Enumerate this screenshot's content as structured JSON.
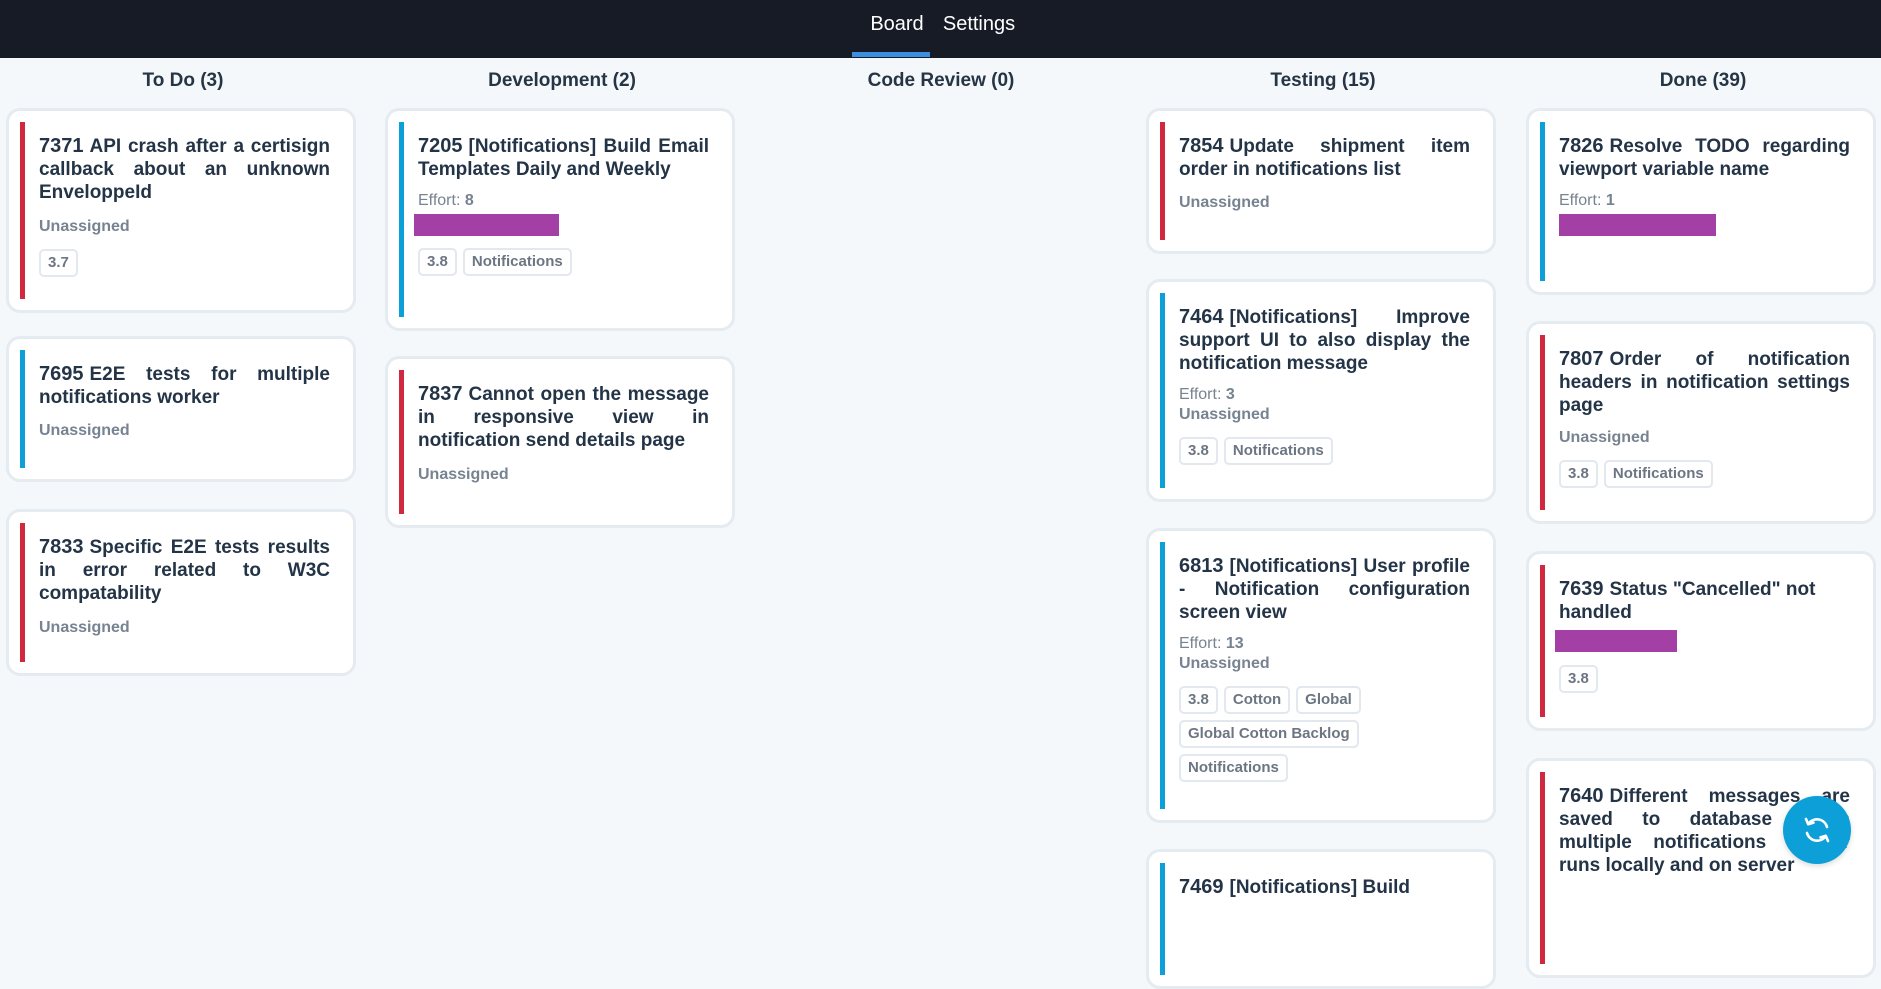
{
  "nav": {
    "board": "Board",
    "settings": "Settings"
  },
  "columns": [
    {
      "header": "To Do (3)",
      "cards": [
        {
          "num": "7371",
          "title": "API crash after a certisign callback about an unknown EnveloppeId",
          "assignee": "Unassigned",
          "tags": [
            "3.7"
          ],
          "stripe": "#d0283e"
        },
        {
          "num": "7695",
          "title": "E2E tests for multiple notifications worker",
          "assignee": "Unassigned",
          "stripe": "#0d9fd8"
        },
        {
          "num": "7833",
          "title": "Specific E2E tests results in error related to W3C compatability",
          "assignee": "Unassigned",
          "stripe": "#d0283e"
        }
      ]
    },
    {
      "header": "Development (2)",
      "cards": [
        {
          "num": "7205",
          "title": "[Notifications] Build Email Templates Daily and Weekly",
          "effort_label": "Effort:",
          "effort": "8",
          "effort_fraction": 0.5,
          "tags": [
            "3.8",
            "Notifications"
          ],
          "stripe": "#0d9fd8"
        },
        {
          "num": "7837",
          "title": "Cannot open the message in responsive view in notification send details page",
          "assignee": "Unassigned",
          "stripe": "#d0283e"
        }
      ]
    },
    {
      "header": "Code Review (0)",
      "cards": []
    },
    {
      "header": "Testing (15)",
      "cards": [
        {
          "num": "7854",
          "title": "Update shipment item order in notifications list",
          "assignee": "Unassigned",
          "stripe": "#d0283e"
        },
        {
          "num": "7464",
          "title": "[Notifications] Improve support UI to also display the notification message",
          "effort_label": "Effort:",
          "effort": "3",
          "assignee": "Unassigned",
          "tags": [
            "3.8",
            "Notifications"
          ],
          "stripe": "#0d9fd8"
        },
        {
          "num": "6813",
          "title": "[Notifications] User profile - Notification configuration screen view",
          "effort_label": "Effort:",
          "effort": "13",
          "assignee": "Unassigned",
          "tags": [
            "3.8",
            "Cotton",
            "Global",
            "Global Cotton Backlog",
            "Notifications"
          ],
          "stripe": "#0d9fd8"
        },
        {
          "num": "7469",
          "title": "[Notifications] Build",
          "stripe": "#0d9fd8"
        }
      ]
    },
    {
      "header": "Done (39)",
      "cards": [
        {
          "num": "7826",
          "title": "Resolve TODO regarding viewport variable name",
          "effort_label": "Effort:",
          "effort": "1",
          "effort_fraction": 0.54,
          "stripe": "#0d9fd8"
        },
        {
          "num": "7807",
          "title": "Order of notification headers in notification settings page",
          "assignee": "Unassigned",
          "tags": [
            "3.8",
            "Notifications"
          ],
          "stripe": "#d0283e"
        },
        {
          "num": "7639",
          "title": "Status \"Cancelled\" not handled",
          "effort_fraction": 0.42,
          "tags": [
            "3.8"
          ],
          "stripe": "#d0283e"
        },
        {
          "num": "7640",
          "title": "Different messages are saved to database when multiple notifications worker runs locally and on server",
          "stripe": "#d0283e"
        }
      ]
    }
  ],
  "refresh": {
    "icon": "refresh-icon",
    "color": "#0d9fd8"
  }
}
